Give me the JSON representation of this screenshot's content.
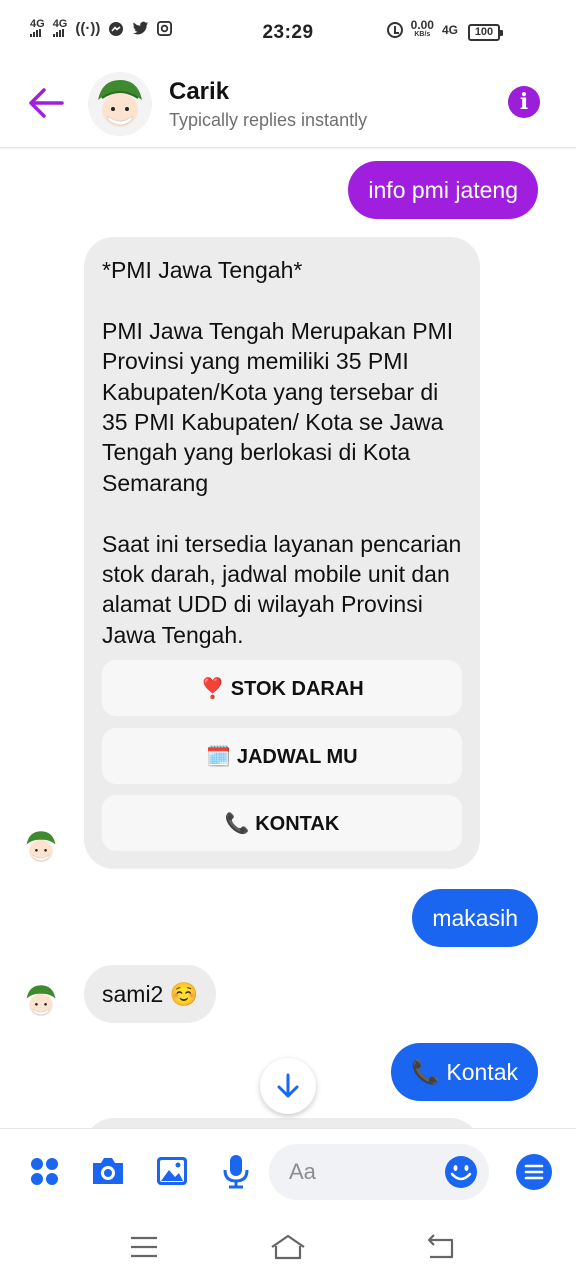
{
  "status_bar": {
    "network_left_1": "4G",
    "network_left_2": "4G",
    "time": "23:29",
    "net_speed_value": "0.00",
    "net_speed_unit": "KB/s",
    "network_right": "4G",
    "battery": "100"
  },
  "header": {
    "contact_name": "Carik",
    "contact_status": "Typically replies instantly",
    "accent_color": "#a01fde"
  },
  "messages": {
    "out_1": "info pmi jateng",
    "bot_card_text": "*PMI Jawa Tengah*\n\nPMI Jawa Tengah Merupakan PMI Provinsi yang memiliki 35 PMI Kabupaten/Kota yang tersebar di 35 PMI Kabupaten/ Kota se Jawa Tengah yang berlokasi di Kota Semarang\n\nSaat ini tersedia layanan pencarian stok darah, jadwal mobile unit dan alamat UDD di wilayah Provinsi Jawa Tengah.",
    "quick_replies": [
      {
        "emoji": "❣️",
        "label": "STOK DARAH"
      },
      {
        "emoji": "🗓️",
        "label": "JADWAL MU"
      },
      {
        "emoji": "📞",
        "label": "KONTAK"
      }
    ],
    "out_2": "makasih",
    "in_2": "sami2 ☺️",
    "out_3": "📞 Kontak"
  },
  "composer": {
    "placeholder": "Aa",
    "accent_color": "#1a66f0"
  },
  "icons": {
    "back": "back-arrow-icon",
    "info": "info-icon",
    "grid": "apps-grid-icon",
    "camera": "camera-icon",
    "gallery": "image-icon",
    "mic": "microphone-icon",
    "emoji": "emoji-icon",
    "menu": "menu-icon",
    "scroll_down": "arrow-down-icon"
  }
}
